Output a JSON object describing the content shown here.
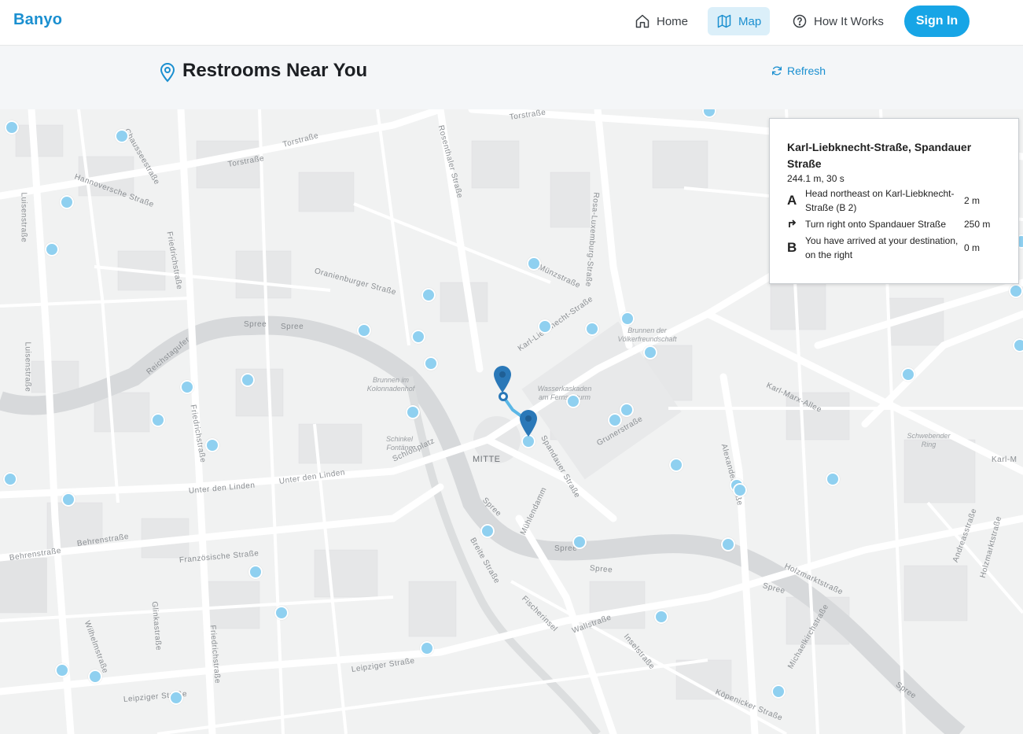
{
  "brand": "Banyo",
  "nav": {
    "home": "Home",
    "map": "Map",
    "how": "How It Works",
    "signin": "Sign In"
  },
  "page": {
    "title": "Restrooms Near You",
    "refresh": "Refresh"
  },
  "directions": {
    "title": "Karl-Liebknecht-Straße, Spandauer Straße",
    "summary": "244.1 m, 30 s",
    "steps": [
      {
        "icon": "A",
        "text": "Head northeast on Karl-Liebknecht-Straße (B 2)",
        "distance": "2 m"
      },
      {
        "icon": "turn-right-icon",
        "text": "Turn right onto Spandauer Straße",
        "distance": "250 m"
      },
      {
        "icon": "B",
        "text": "You have arrived at your destination, on the right",
        "distance": "0 m"
      }
    ]
  },
  "map_labels": {
    "district": "MITTE",
    "streets": [
      "Torstraße",
      "Torstraße",
      "Torstraße",
      "Chausseestraße",
      "Hannoversche Straße",
      "Luisenstraße",
      "Friedrichstraße",
      "Oranienburger Straße",
      "Rosenthaler Straße",
      "Rosa-Luxemburg-Straße",
      "Münzstraße",
      "Spree",
      "Spree",
      "Luisenstraße",
      "Reichstagufer",
      "Friedrichstraße",
      "Karl-Liebknecht-Straße",
      "Karl-Marx-Allee",
      "Alexanderstraße",
      "Grunerstraße",
      "Spandauer Straße",
      "Schloßplatz",
      "Unter den Linden",
      "Unter den Linden",
      "Behrenstraße",
      "Behrenstraße",
      "Französische Straße",
      "Spree",
      "Spree",
      "Mühlendamm",
      "Breite Straße",
      "Spree",
      "Spree",
      "Holzmarktstraße",
      "Holzmarktstraße",
      "Wilhelmstraße",
      "Glinkastraße",
      "Friedrichstraße",
      "Leipziger Straße",
      "Leipziger Straße",
      "Fischerinsel",
      "Wallstraße",
      "Inselstraße",
      "Köpenicker Straße",
      "Michaelkirchstraße",
      "Spree",
      "Andreasstraße",
      "Karl-M"
    ],
    "pois": [
      "Brunnen der Völkerfreundschaft",
      "Brunnen im Kolonnadenhof",
      "Wasserkaskaden am Fernsehturm",
      "Schinkel Fontäne",
      "Schwebender Ring"
    ]
  },
  "restroom_markers_count": 44,
  "colors": {
    "accent": "#17a5e6",
    "marker": "#8fd0f0",
    "route_pin": "#2a78b8"
  }
}
